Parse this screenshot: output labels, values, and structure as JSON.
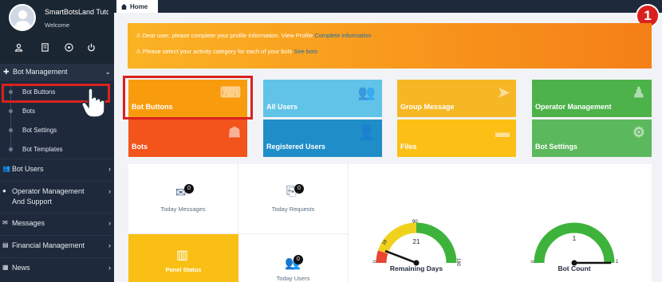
{
  "sidebar": {
    "user_name": "SmartBotsLand Tuto",
    "welcome": "Welcome",
    "profile_actions": [
      "user-icon",
      "document-icon",
      "help-icon",
      "power-icon"
    ],
    "bot_management": "Bot Management",
    "sub_items": [
      "Bot Buttons",
      "Bots",
      "Bot Settings",
      "Bot Templates"
    ],
    "lower_items": [
      "Bot Users",
      "Operator Management And Support",
      "Messages",
      "Financial Management",
      "News"
    ]
  },
  "tabbar": {
    "home": "Home",
    "step_badge": "1"
  },
  "notice": {
    "line1_text": "Dear user, please complete your profile information. View Profile",
    "line1_link": "Complete information",
    "line2_text": "Please select your activity category for each of your bots",
    "line2_link": "See bots"
  },
  "tiles": [
    {
      "label": "Bot Buttons",
      "icon": "keyboard-icon"
    },
    {
      "label": "All Users",
      "icon": "users-icon"
    },
    {
      "label": "Group Message",
      "icon": "paper-plane-icon"
    },
    {
      "label": "Operator Management",
      "icon": "operator-icon"
    },
    {
      "label": "Bots",
      "icon": "android-icon"
    },
    {
      "label": "Registered Users",
      "icon": "user-icon"
    },
    {
      "label": "Files",
      "icon": "folder-icon"
    },
    {
      "label": "Bot Settings",
      "icon": "gear-icon"
    }
  ],
  "stats": {
    "today_messages": {
      "label": "Today Messages",
      "count": "0"
    },
    "today_requests": {
      "label": "Today Requests",
      "count": "0"
    },
    "panel_status": {
      "label": "Panel Status"
    },
    "today_users": {
      "label": "Today Users",
      "count": "0"
    }
  },
  "gauges": {
    "remaining_days": {
      "label": "Remaining Days",
      "value": "21",
      "min": "0",
      "max": "180",
      "tick_18": "18",
      "tick_90": "90",
      "value_num": 21,
      "max_num": 180
    },
    "bot_count": {
      "label": "Bot Count",
      "value": "1",
      "min": "0",
      "max": "1",
      "value_num": 1,
      "max_num": 1
    }
  },
  "colors": {
    "sidebar": "#1e2a3b",
    "highlight": "#d9221f",
    "gauge_green": "#3db33b",
    "gauge_yellow": "#f0d21e",
    "gauge_red": "#e94434"
  }
}
